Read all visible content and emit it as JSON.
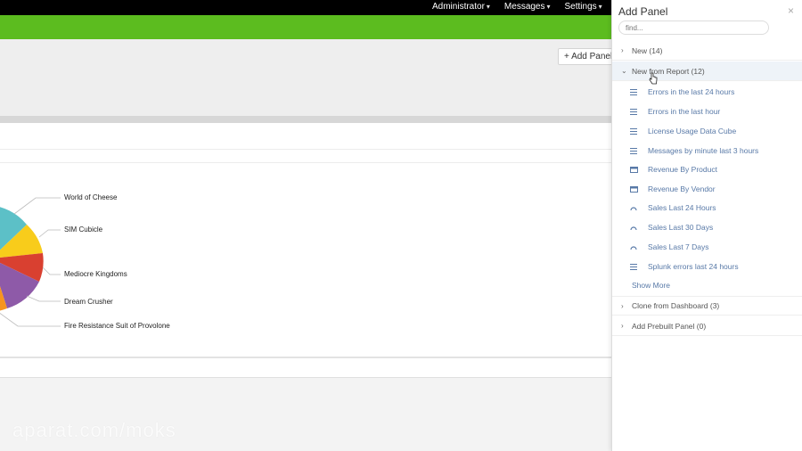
{
  "topnav": {
    "items": [
      {
        "label": "Administrator"
      },
      {
        "label": "Messages"
      },
      {
        "label": "Settings"
      }
    ]
  },
  "toolbar": {
    "add_panel_label": "+ Add Panel"
  },
  "chart_data": {
    "type": "pie",
    "labels": [
      "World of Cheese",
      "SIM Cubicle",
      "Mediocre Kingdoms",
      "Dream Crusher",
      "Fire Resistance Suit of Provolone"
    ],
    "colors": [
      "#5cc0c7",
      "#f8cc1b",
      "#d94030",
      "#8e5aa8",
      "#f7941d"
    ]
  },
  "watermark": "aparat.com/moks",
  "side_panel": {
    "title": "Add Panel",
    "close": "×",
    "search_placeholder": "find...",
    "groups": [
      {
        "label": "New (14)"
      },
      {
        "label": "New from Report (12)"
      },
      {
        "label": "Clone from Dashboard (3)"
      },
      {
        "label": "Add Prebuilt Panel (0)"
      }
    ],
    "report_items": [
      {
        "label": "Errors in the last 24 hours",
        "icon": "list-icon"
      },
      {
        "label": "Errors in the last hour",
        "icon": "list-icon"
      },
      {
        "label": "License Usage Data Cube",
        "icon": "list-icon"
      },
      {
        "label": "Messages by minute last 3 hours",
        "icon": "list-icon"
      },
      {
        "label": "Revenue By Product",
        "icon": "table-icon"
      },
      {
        "label": "Revenue By Vendor",
        "icon": "table-icon"
      },
      {
        "label": "Sales Last 24 Hours",
        "icon": "gauge-icon"
      },
      {
        "label": "Sales Last 30 Days",
        "icon": "gauge-icon"
      },
      {
        "label": "Sales Last 7 Days",
        "icon": "gauge-icon"
      },
      {
        "label": "Splunk errors last 24 hours",
        "icon": "list-icon"
      }
    ],
    "show_more": "Show More"
  }
}
